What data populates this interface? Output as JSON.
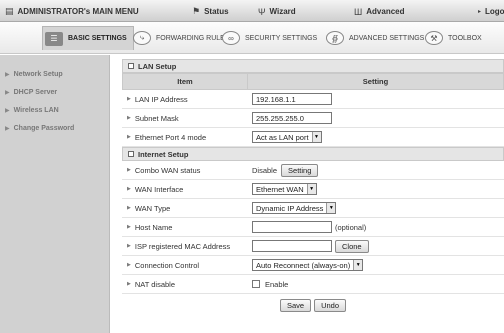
{
  "topmenu": {
    "admin": "ADMINISTRATOR's MAIN MENU",
    "status": "Status",
    "wizard": "Wizard",
    "advanced": "Advanced",
    "logout": "Logo"
  },
  "tabs": [
    {
      "label": "BASIC SETTINGS",
      "icon": "settings-icon"
    },
    {
      "label": "FORWARDING RULES",
      "icon": "forwarding-icon"
    },
    {
      "label": "SECURITY SETTINGS",
      "icon": "security-icon"
    },
    {
      "label": "ADVANCED SETTINGS",
      "icon": "advanced-settings-icon"
    },
    {
      "label": "TOOLBOX",
      "icon": "toolbox-icon"
    }
  ],
  "sidebar": {
    "items": [
      {
        "label": "Network Setup"
      },
      {
        "label": "DHCP Server"
      },
      {
        "label": "Wireless LAN"
      },
      {
        "label": "Change Password"
      }
    ]
  },
  "lan": {
    "section_title": "LAN Setup",
    "col_item": "Item",
    "col_setting": "Setting",
    "ip_label": "LAN IP Address",
    "ip_value": "192.168.1.1",
    "mask_label": "Subnet Mask",
    "mask_value": "255.255.255.0",
    "port4_label": "Ethernet Port 4 mode",
    "port4_value": "Act as LAN port"
  },
  "internet": {
    "section_title": "Internet Setup",
    "combo_label": "Combo WAN status",
    "combo_status": "Disable",
    "combo_button": "Setting",
    "wan_if_label": "WAN Interface",
    "wan_if_value": "Ethernet WAN",
    "wan_type_label": "WAN Type",
    "wan_type_value": "Dynamic IP Address",
    "host_label": "Host Name",
    "host_value": "",
    "host_hint": "(optional)",
    "mac_label": "ISP registered MAC Address",
    "mac_value": "",
    "clone_button": "Clone",
    "conn_label": "Connection Control",
    "conn_value": "Auto Reconnect (always-on)",
    "nat_label": "NAT disable",
    "nat_enable": "Enable"
  },
  "actions": {
    "save": "Save",
    "undo": "Undo"
  }
}
